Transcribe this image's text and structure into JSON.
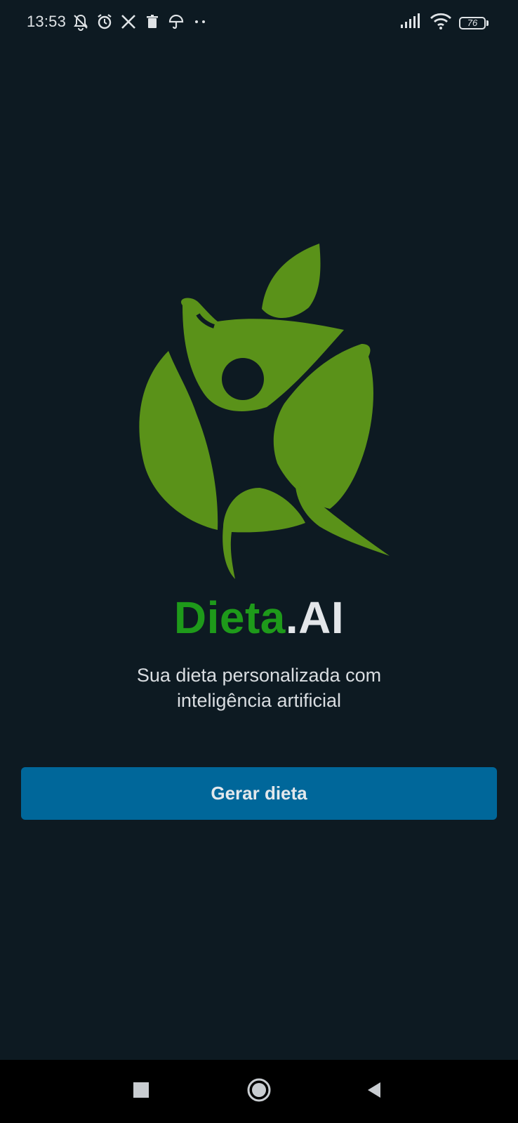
{
  "status_bar": {
    "time": "13:53",
    "battery_level": "76",
    "icons_left": [
      "mute-notifications-icon",
      "alarm-icon",
      "x-app-icon",
      "trash-icon",
      "umbrella-icon",
      "more-dots-icon"
    ],
    "icons_right": [
      "signal-icon",
      "wifi-icon",
      "battery-icon"
    ]
  },
  "brand": {
    "name_part1": "Dieta",
    "name_part2": ".AI",
    "color_primary": "#1e9a1a",
    "color_secondary": "#e3e6e9"
  },
  "tagline": {
    "line1": "Sua dieta personalizada com",
    "line2": "inteligência artificial"
  },
  "cta": {
    "label": "Gerar dieta",
    "color": "#00679a"
  },
  "logo": {
    "icon": "leaf-person-logo",
    "color": "#5a9219"
  },
  "nav_bar": {
    "buttons": [
      "recents-square-icon",
      "home-circle-icon",
      "back-triangle-icon"
    ]
  }
}
